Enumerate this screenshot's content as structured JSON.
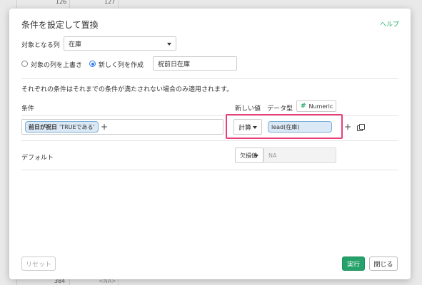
{
  "background": {
    "top_values": [
      "126",
      "127"
    ],
    "bottom_values": [
      "384",
      "<NA>"
    ]
  },
  "dialog": {
    "title": "条件を設定して置換",
    "help_link": "ヘルプ",
    "target_column_label": "対象となる列",
    "target_column_value": "在庫",
    "overwrite_option_label": "対象の列を上書き",
    "new_column_option_label": "新しく列を作成",
    "new_column_name": "祝前日在庫",
    "selected_option": "new_column",
    "info_text": "それぞれの条件はそれまでの条件が満たされない場合のみ適用されます。",
    "conditions_header": "条件",
    "new_value_header": "新しい値",
    "data_type_header": "データ型",
    "data_type_icon": "hash-icon",
    "data_type_value": "Numeric",
    "condition_pill": {
      "column": "前日が祝日",
      "value": "'TRUEである'"
    },
    "add_condition_symbol": "+",
    "value_mode": "計算",
    "value_expression": "lead(在庫)",
    "add_row_symbol": "+",
    "default_label": "デフォルト",
    "default_mode": "欠損値",
    "default_value": "NA",
    "reset_button": "リセット",
    "run_button": "実行",
    "close_button": "閉じる"
  },
  "colors": {
    "accent_green": "#25a16a",
    "highlight_pink": "#e83e7a",
    "pill_blue": "#dbe9f6"
  }
}
